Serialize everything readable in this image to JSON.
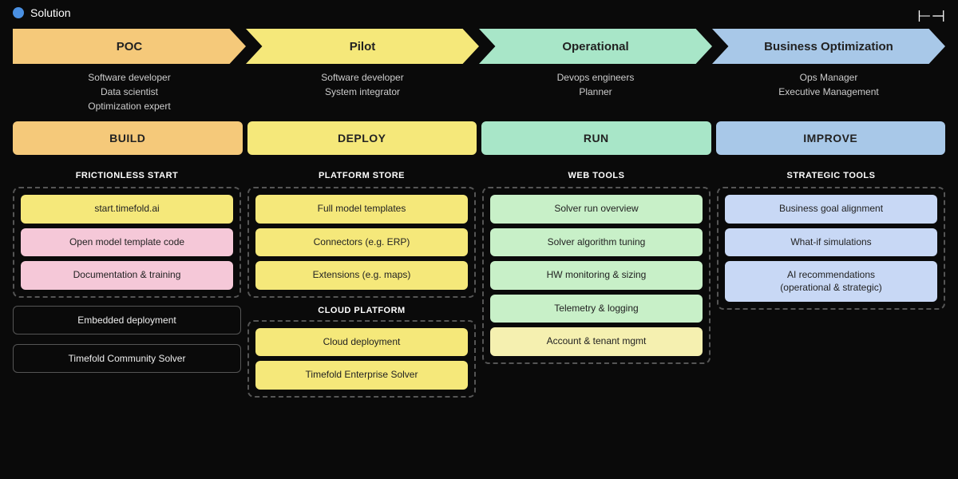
{
  "header": {
    "solution_label": "Solution",
    "logo_symbol": "⊤"
  },
  "phases": [
    {
      "id": "poc",
      "label": "POC",
      "class": "phase-poc"
    },
    {
      "id": "pilot",
      "label": "Pilot",
      "class": "phase-pilot"
    },
    {
      "id": "operational",
      "label": "Operational",
      "class": "phase-operational"
    },
    {
      "id": "bizopt",
      "label": "Business Optimization",
      "class": "phase-bizopt"
    }
  ],
  "personas": [
    {
      "id": "poc-persona",
      "text": "Software developer\nData scientist\nOptimization expert"
    },
    {
      "id": "pilot-persona",
      "text": "Software developer\nSystem integrator"
    },
    {
      "id": "ops-persona",
      "text": "Devops engineers\nPlanner"
    },
    {
      "id": "mgmt-persona",
      "text": "Ops Manager\nExecutive Management"
    }
  ],
  "actions": [
    {
      "id": "build",
      "label": "BUILD",
      "class": "btn-build"
    },
    {
      "id": "deploy",
      "label": "DEPLOY",
      "class": "btn-deploy"
    },
    {
      "id": "run",
      "label": "RUN",
      "class": "btn-run"
    },
    {
      "id": "improve",
      "label": "IMPROVE",
      "class": "btn-improve"
    }
  ],
  "columns": {
    "frictionless": {
      "title": "FRICTIONLESS START",
      "items": [
        {
          "label": "start.timefold.ai",
          "class": "card-yellow"
        },
        {
          "label": "Open model template code",
          "class": "card-pink"
        },
        {
          "label": "Documentation & training",
          "class": "card-pink"
        }
      ],
      "bottom_label": "",
      "bottom_items": [
        {
          "label": "Embedded deployment",
          "standalone": true
        },
        {
          "label": "Timefold Community Solver",
          "standalone": true
        }
      ]
    },
    "platform": {
      "title": "PLATFORM STORE",
      "items": [
        {
          "label": "Full model templates",
          "class": "card-yellow"
        },
        {
          "label": "Connectors (e.g. ERP)",
          "class": "card-yellow"
        },
        {
          "label": "Extensions (e.g. maps)",
          "class": "card-yellow"
        }
      ],
      "bottom_label": "CLOUD PLATFORM",
      "bottom_items": [
        {
          "label": "Cloud deployment",
          "class": "card-yellow",
          "dashed": true
        },
        {
          "label": "Timefold Enterprise Solver",
          "class": "card-yellow",
          "dashed": true
        }
      ]
    },
    "webtools": {
      "title": "WEB TOOLS",
      "items": [
        {
          "label": "Solver run overview",
          "class": "card-light-green"
        },
        {
          "label": "Solver algorithm tuning",
          "class": "card-light-green"
        },
        {
          "label": "HW monitoring & sizing",
          "class": "card-light-green"
        },
        {
          "label": "Telemetry & logging",
          "class": "card-light-green"
        },
        {
          "label": "Account & tenant mgmt",
          "class": "card-light-yellow"
        }
      ]
    },
    "strategic": {
      "title": "STRATEGIC TOOLS",
      "items": [
        {
          "label": "Business goal alignment",
          "class": "card-light-blue"
        },
        {
          "label": "What-if simulations",
          "class": "card-light-blue"
        },
        {
          "label": "AI recommendations\n(operational & strategic)",
          "class": "card-light-blue"
        }
      ]
    }
  }
}
